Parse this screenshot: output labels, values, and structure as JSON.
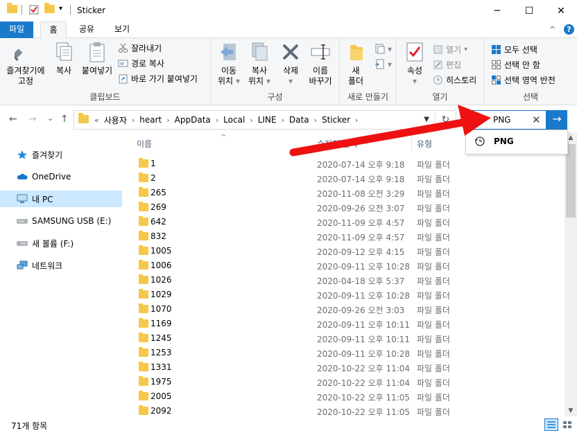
{
  "window": {
    "title": "Sticker",
    "minimize": "─",
    "maximize": "☐",
    "close": "✕"
  },
  "tabs": {
    "file": "파일",
    "home": "홈",
    "share": "공유",
    "view": "보기",
    "expand": "^",
    "help": "?"
  },
  "ribbon": {
    "clipboard": {
      "label": "클립보드",
      "pin_line1": "즐겨찾기에",
      "pin_line2": "고정",
      "copy": "복사",
      "paste": "붙여넣기",
      "cut": "잘라내기",
      "copy_path": "경로 복사",
      "paste_shortcut": "바로 가기 붙여넣기"
    },
    "organize": {
      "label": "구성",
      "move_line1": "이동",
      "move_line2": "위치",
      "copyto_line1": "복사",
      "copyto_line2": "위치",
      "delete": "삭제",
      "rename_line1": "이름",
      "rename_line2": "바꾸기"
    },
    "new": {
      "label": "새로 만들기",
      "newfolder_line1": "새",
      "newfolder_line2": "폴더"
    },
    "open": {
      "label": "열기",
      "properties": "속성",
      "open": "열기",
      "edit": "편집",
      "history": "히스토리"
    },
    "select": {
      "label": "선택",
      "select_all": "모두 선택",
      "select_none": "선택 안 함",
      "invert": "선택 영역 반전"
    }
  },
  "nav": {
    "back": "←",
    "forward": "→",
    "recent": "⌄",
    "up": "↑"
  },
  "address": {
    "overflow": "«",
    "crumbs": [
      "사용자",
      "heart",
      "AppData",
      "Local",
      "LINE",
      "Data",
      "Sticker"
    ],
    "refresh": "↻"
  },
  "search": {
    "query": "PNG",
    "clear": "✕",
    "go": "→",
    "suggestion": "PNG"
  },
  "navpane": {
    "quick_access": "즐겨찾기",
    "onedrive": "OneDrive",
    "this_pc": "내 PC",
    "usb": "SAMSUNG USB (E:)",
    "volume": "새 볼륨 (F:)",
    "network": "네트워크"
  },
  "columns": {
    "name": "이름",
    "date": "수정한 날짜",
    "type": "유형"
  },
  "files": [
    {
      "name": "1",
      "date": "2020-07-14 오후 9:18",
      "type": "파일 폴더"
    },
    {
      "name": "2",
      "date": "2020-07-14 오후 9:18",
      "type": "파일 폴더"
    },
    {
      "name": "265",
      "date": "2020-11-08 오전 3:29",
      "type": "파일 폴더"
    },
    {
      "name": "269",
      "date": "2020-09-26 오전 3:07",
      "type": "파일 폴더"
    },
    {
      "name": "642",
      "date": "2020-11-09 오후 4:57",
      "type": "파일 폴더"
    },
    {
      "name": "832",
      "date": "2020-11-09 오후 4:57",
      "type": "파일 폴더"
    },
    {
      "name": "1005",
      "date": "2020-09-12 오후 4:15",
      "type": "파일 폴더"
    },
    {
      "name": "1006",
      "date": "2020-09-11 오후 10:28",
      "type": "파일 폴더"
    },
    {
      "name": "1026",
      "date": "2020-04-18 오후 5:37",
      "type": "파일 폴더"
    },
    {
      "name": "1029",
      "date": "2020-09-11 오후 10:28",
      "type": "파일 폴더"
    },
    {
      "name": "1070",
      "date": "2020-09-26 오전 3:03",
      "type": "파일 폴더"
    },
    {
      "name": "1169",
      "date": "2020-09-11 오후 10:11",
      "type": "파일 폴더"
    },
    {
      "name": "1245",
      "date": "2020-09-11 오후 10:11",
      "type": "파일 폴더"
    },
    {
      "name": "1253",
      "date": "2020-09-11 오후 10:28",
      "type": "파일 폴더"
    },
    {
      "name": "1331",
      "date": "2020-10-22 오후 11:04",
      "type": "파일 폴더"
    },
    {
      "name": "1975",
      "date": "2020-10-22 오후 11:04",
      "type": "파일 폴더"
    },
    {
      "name": "2005",
      "date": "2020-10-22 오후 11:05",
      "type": "파일 폴더"
    },
    {
      "name": "2092",
      "date": "2020-10-22 오후 11:05",
      "type": "파일 폴더"
    }
  ],
  "status": {
    "count": "71개 항목"
  },
  "colors": {
    "accent": "#1979ca",
    "folder": "#f4c84a",
    "selection": "#cce8ff",
    "annotation_arrow": "#ee1111"
  }
}
